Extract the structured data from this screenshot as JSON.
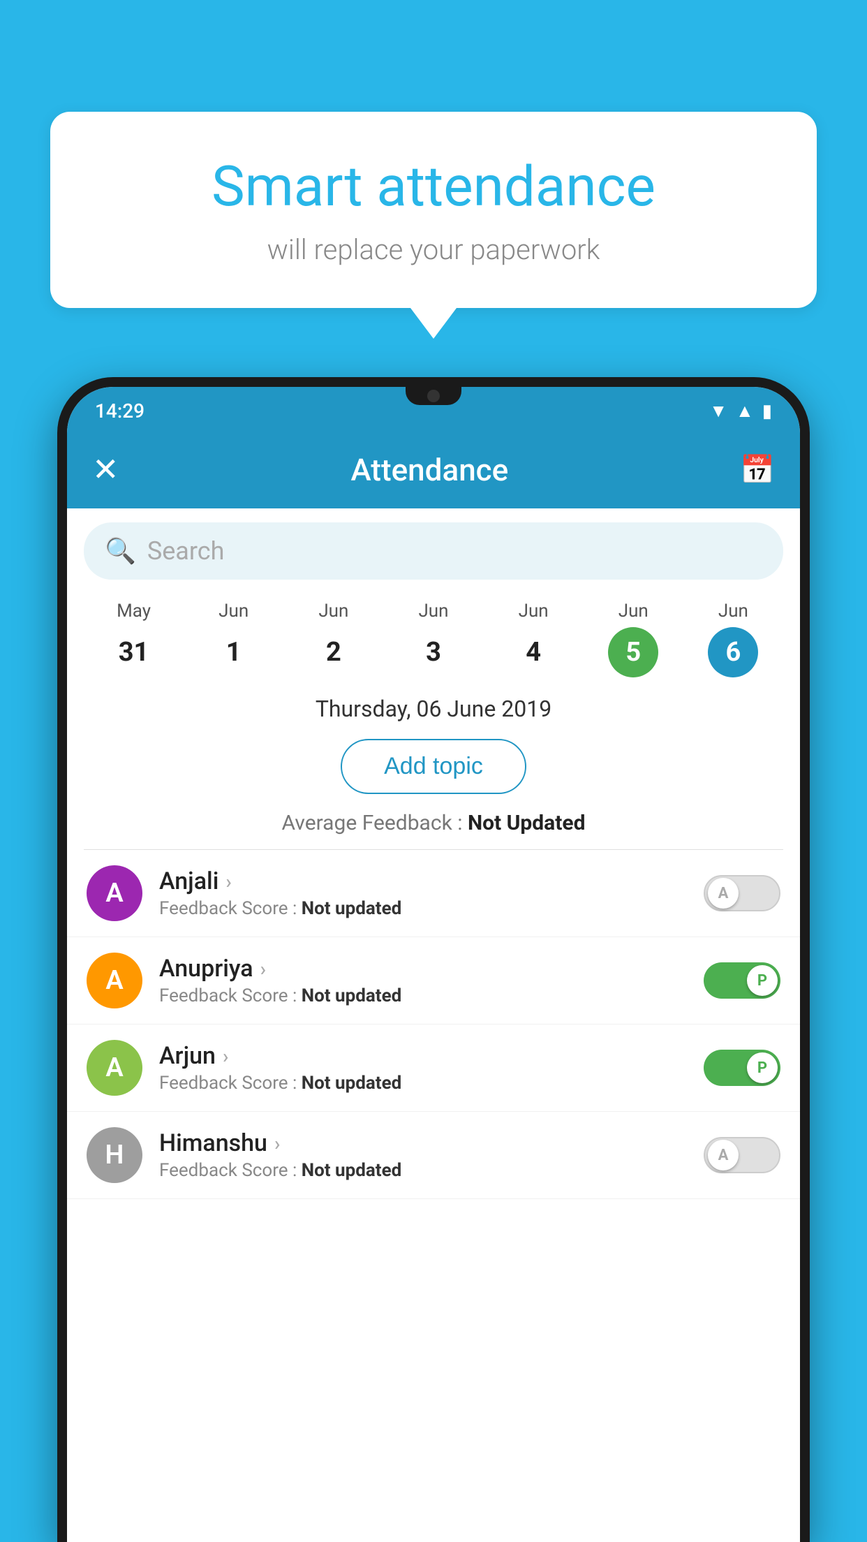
{
  "background_color": "#29b6e8",
  "bubble": {
    "title": "Smart attendance",
    "subtitle": "will replace your paperwork"
  },
  "status_bar": {
    "time": "14:29",
    "signal_icon": "▲",
    "wifi_icon": "▼",
    "battery_icon": "▮"
  },
  "app_bar": {
    "title": "Attendance",
    "close_icon": "✕",
    "calendar_icon": "📅"
  },
  "search": {
    "placeholder": "Search"
  },
  "calendar": {
    "days": [
      {
        "month": "May",
        "date": "31",
        "style": "normal"
      },
      {
        "month": "Jun",
        "date": "1",
        "style": "normal"
      },
      {
        "month": "Jun",
        "date": "2",
        "style": "normal"
      },
      {
        "month": "Jun",
        "date": "3",
        "style": "normal"
      },
      {
        "month": "Jun",
        "date": "4",
        "style": "normal"
      },
      {
        "month": "Jun",
        "date": "5",
        "style": "green"
      },
      {
        "month": "Jun",
        "date": "6",
        "style": "blue"
      }
    ]
  },
  "selected_date": "Thursday, 06 June 2019",
  "add_topic_label": "Add topic",
  "avg_feedback_label": "Average Feedback : ",
  "avg_feedback_value": "Not Updated",
  "students": [
    {
      "name": "Anjali",
      "avatar_letter": "A",
      "avatar_color": "#9c27b0",
      "feedback_label": "Feedback Score : ",
      "feedback_value": "Not updated",
      "toggle": "off",
      "toggle_letter": "A"
    },
    {
      "name": "Anupriya",
      "avatar_letter": "A",
      "avatar_color": "#ff9800",
      "feedback_label": "Feedback Score : ",
      "feedback_value": "Not updated",
      "toggle": "on",
      "toggle_letter": "P"
    },
    {
      "name": "Arjun",
      "avatar_letter": "A",
      "avatar_color": "#8bc34a",
      "feedback_label": "Feedback Score : ",
      "feedback_value": "Not updated",
      "toggle": "on",
      "toggle_letter": "P"
    },
    {
      "name": "Himanshu",
      "avatar_letter": "H",
      "avatar_color": "#9e9e9e",
      "feedback_label": "Feedback Score : ",
      "feedback_value": "Not updated",
      "toggle": "off",
      "toggle_letter": "A"
    }
  ]
}
